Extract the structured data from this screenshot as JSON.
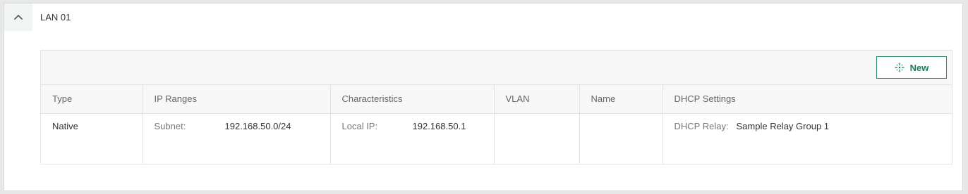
{
  "section": {
    "title": "LAN 01",
    "collapse_icon": "chevron-up-icon"
  },
  "toolbar": {
    "new_label": "New",
    "new_icon": "sparkle-icon"
  },
  "colors": {
    "accent": "#1f7a5c",
    "header_bg": "#f7f7f7",
    "border": "#e3e3e3"
  },
  "table": {
    "columns": [
      "Type",
      "IP Ranges",
      "Characteristics",
      "VLAN",
      "Name",
      "DHCP Settings"
    ],
    "rows": [
      {
        "type": "Native",
        "ip_ranges": {
          "label": "Subnet:",
          "value": "192.168.50.0/24"
        },
        "characteristics": {
          "label": "Local IP:",
          "value": "192.168.50.1"
        },
        "vlan": "",
        "name": "",
        "dhcp": {
          "label": "DHCP Relay:",
          "value": "Sample Relay Group 1"
        }
      }
    ]
  }
}
